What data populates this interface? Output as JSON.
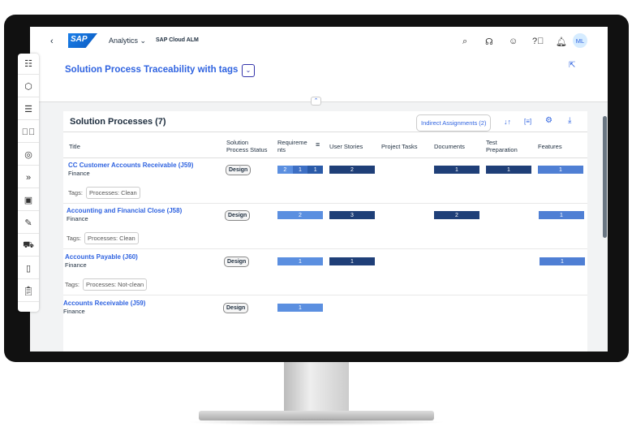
{
  "header": {
    "brand": "SAP",
    "app": "Analytics",
    "product": "SAP Cloud ALM",
    "avatar": "ML"
  },
  "page": {
    "title": "Solution Process Traceability with tags"
  },
  "card": {
    "title": "Solution Processes (7)",
    "indirect_button": "Indirect Assignments (2)"
  },
  "columns": [
    "Title",
    "Solution Process Status",
    "Requirements",
    "User Stories",
    "Project Tasks",
    "Documents",
    "Test Preparation",
    "Features"
  ],
  "tags_label": "Tags:",
  "rows": [
    {
      "title": "CC Customer Accounts Receivable (J59)",
      "area": "Finance",
      "status": "Design",
      "req": [
        "2",
        "1",
        "1"
      ],
      "stories": "2",
      "documents": "1",
      "test_prep": "1",
      "features": "1",
      "tag": "Processes: Clean"
    },
    {
      "title": "Accounting and Financial Close (J58)",
      "area": "Finance",
      "status": "Design",
      "req": [
        "2"
      ],
      "stories": "3",
      "documents": "2",
      "features": "1",
      "tag": "Processes: Clean"
    },
    {
      "title": "Accounts Payable (J60)",
      "area": "Finance",
      "status": "Design",
      "req": [
        "1"
      ],
      "stories": "1",
      "features": "1",
      "tag": "Processes: Not-clean"
    },
    {
      "title": "Accounts Receivable (J59)",
      "area": "Finance",
      "status": "Design",
      "req": [
        "1"
      ]
    }
  ]
}
